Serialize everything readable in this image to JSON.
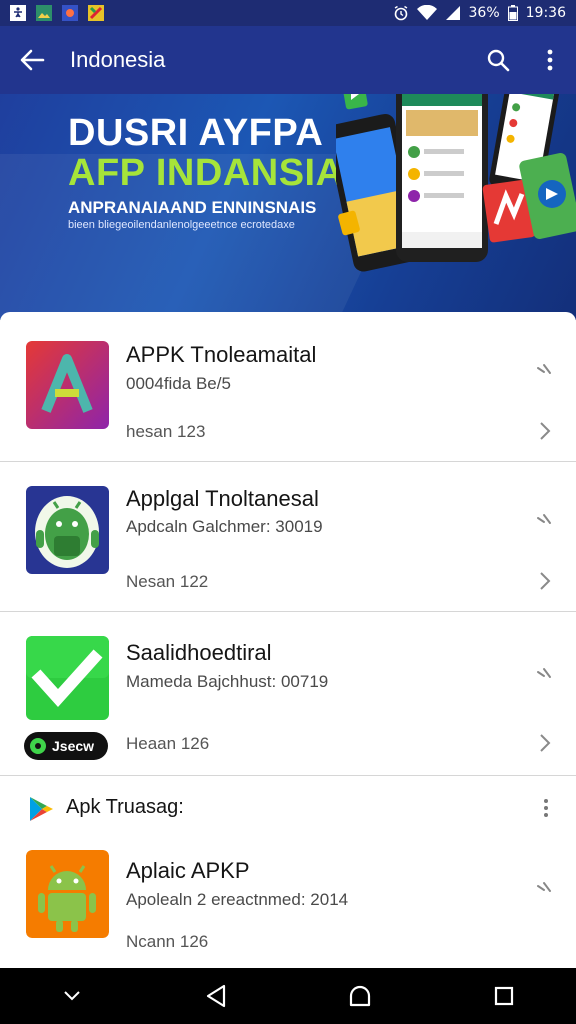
{
  "status_bar": {
    "time": "19:36",
    "battery_text": "36%",
    "left_icons": [
      "accessibility-icon",
      "photos-icon",
      "app-notification-icon",
      "game-notification-icon"
    ],
    "right_icons": [
      "alarm-icon",
      "wifi-icon",
      "signal-icon",
      "battery-icon"
    ]
  },
  "app_bar": {
    "title": "Indonesia",
    "icons": [
      "back-arrow-icon",
      "search-icon",
      "more-vert-icon"
    ]
  },
  "banner": {
    "line1": "DUSRI AYFPA",
    "line2": "AFP INDANSIA",
    "line3": "ANPRANAIAAND ENNINSNAIS",
    "line4": "bieen bliegeoilendanlenolgeeetnce ecrotedaxe"
  },
  "apps": [
    {
      "name": "APPK Tnoleamaital",
      "subtitle": "0004fida Be/5",
      "version": "hesan 123",
      "icon": "apk-a-logo-icon"
    },
    {
      "name": "Applgal Tnoltanesal",
      "subtitle": "Apdcaln Galchmer: 30019",
      "version": "Nesan 122",
      "icon": "android-robot-icon"
    },
    {
      "name": "Saalidhoedtiral",
      "subtitle": "Mameda Bajchhust: 00719",
      "version": "Heaan 126",
      "icon": "download-arrow-icon",
      "badge": "Jsecw"
    },
    {
      "name": "Aplaic APKP",
      "subtitle": "Apolealn 2 ereactnmed: 2014",
      "version": "Ncann 126",
      "icon": "android-robot-icon"
    }
  ],
  "section": {
    "title": "Apk Truasag:",
    "icon": "play-store-icon"
  },
  "nav_bar": {
    "icons": [
      "collapse-icon",
      "back-triangle-icon",
      "home-icon",
      "recents-icon"
    ]
  },
  "colors": {
    "app_bar": "#22358e",
    "banner_accent": "#a6e43a",
    "banner_text": "#ffffff"
  }
}
